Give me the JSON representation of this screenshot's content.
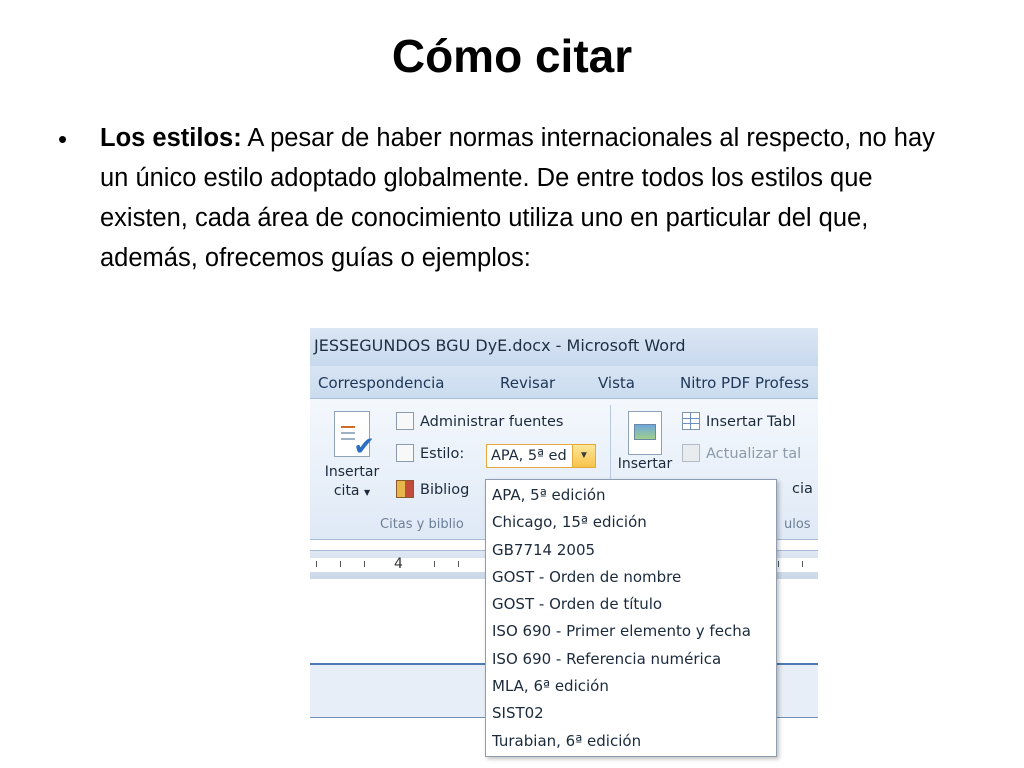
{
  "slide": {
    "title": "Cómo citar",
    "bullet_label": "Los estilos:",
    "bullet_text": " A pesar de haber normas internacionales al respecto, no hay un único estilo adoptado globalmente. De entre todos los estilos que existen, cada área de conocimiento utiliza uno en particular del que, además, ofrecemos  guías o ejemplos:"
  },
  "word": {
    "window_title": "JESSEGUNDOS BGU DyE.docx  -  Microsoft Word",
    "menu": [
      "Correspondencia",
      "Revisar",
      "Vista",
      "Nitro PDF Profess"
    ],
    "insert_citation": "Insertar cita",
    "manage_sources": "Administrar fuentes",
    "style_label": "Estilo:",
    "style_value": "APA, 5ª ed",
    "bibliography": "Bibliog",
    "group_citations": "Citas y biblio",
    "insert_caption": "Insertar",
    "insert_table": "Insertar Tabl",
    "update_table": "Actualizar tal",
    "cross_ref": "cia cr",
    "group_captions": "ulos",
    "ruler_number": "4",
    "style_options": [
      "APA, 5ª edición",
      "Chicago, 15ª edición",
      "GB7714 2005",
      "GOST - Orden de nombre",
      "GOST - Orden de título",
      "ISO 690 - Primer elemento y fecha",
      "ISO 690 - Referencia numérica",
      "MLA, 6ª edición",
      "SIST02",
      "Turabian, 6ª edición"
    ]
  },
  "icons": {
    "bullet": "•",
    "dropdown_arrow": "▼"
  }
}
